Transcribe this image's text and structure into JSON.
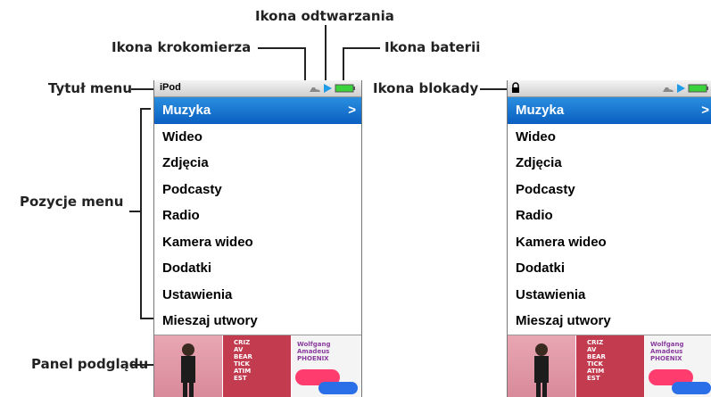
{
  "callouts": {
    "menu_title": "Tytuł menu",
    "menu_items": "Pozycje menu",
    "preview_panel": "Panel podglądu",
    "pedometer_icon": "Ikona krokomierza",
    "play_icon": "Ikona odtwarzania",
    "battery_icon": "Ikona baterii",
    "lock_icon": "Ikona blokady"
  },
  "screen": {
    "title": "iPod",
    "menu": [
      "Muzyka",
      "Wideo",
      "Zdjęcia",
      "Podcasty",
      "Radio",
      "Kamera wideo",
      "Dodatki",
      "Ustawienia",
      "Mieszaj utwory"
    ],
    "selected_index": 0,
    "selected_chevron": ">"
  },
  "album_art": {
    "art2": "CRIZ\nAV\nBEAR\nTICK\nATIM\nEST",
    "art3": "Wolfgang\nAmadeus\nPHOENIX"
  },
  "colors": {
    "selection": "#1576d6",
    "play_icon": "#1f9be8",
    "battery": "#3cd23c"
  },
  "icons": [
    "pedometer-icon",
    "play-icon",
    "battery-icon",
    "lock-icon",
    "chevron-right-icon"
  ]
}
